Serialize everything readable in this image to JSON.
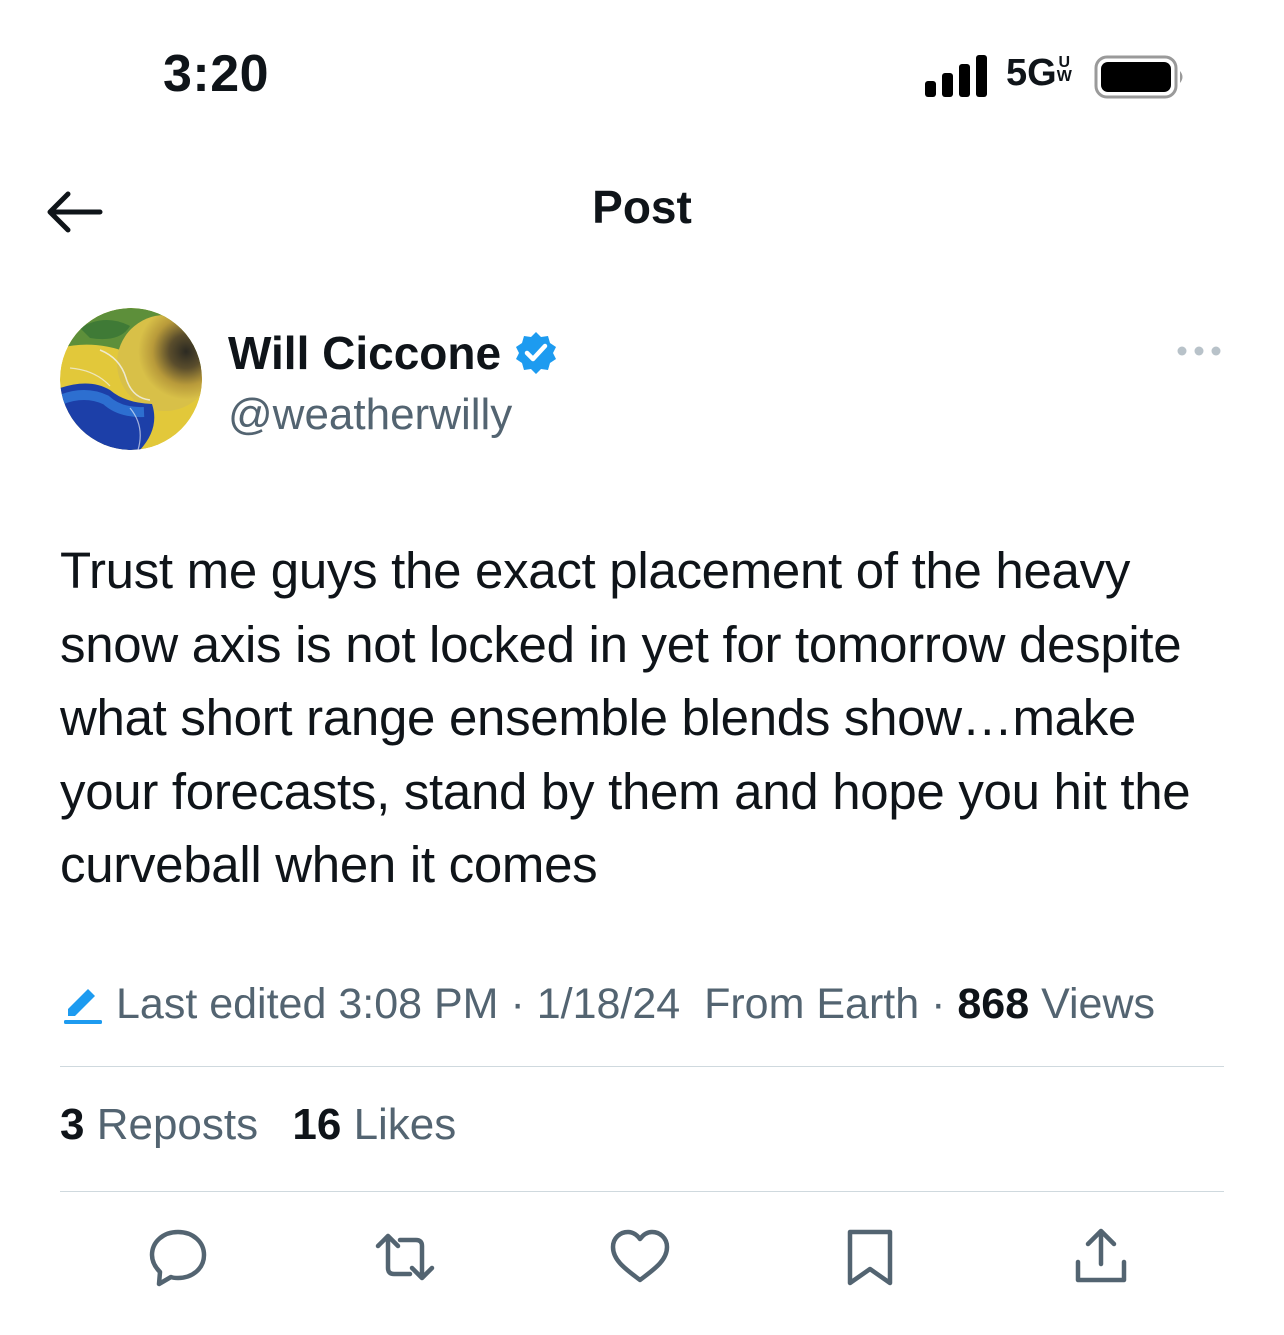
{
  "status_bar": {
    "time": "3:20",
    "network": "5G",
    "network_suffix_top": "U",
    "network_suffix_bottom": "W"
  },
  "nav": {
    "title": "Post",
    "back_icon": "arrow-left-icon"
  },
  "author": {
    "name": "Will Ciccone",
    "handle": "@weatherwilly",
    "verified": true,
    "avatar": "satellite-weather-map-avatar"
  },
  "post": {
    "text": "Trust me guys the exact placement of the heavy snow axis is not locked in yet for tomorrow despite what short range ensemble blends show…make your forecasts, stand by them and hope you hit the curveball when it comes"
  },
  "meta": {
    "edited_prefix": "Last edited",
    "time": "3:08 PM",
    "sep1": "·",
    "date": "1/18/24",
    "location": "From Earth",
    "sep2": "·",
    "views_count": "868",
    "views_label": "Views"
  },
  "stats": {
    "reposts_count": "3",
    "reposts_label": "Reposts",
    "likes_count": "16",
    "likes_label": "Likes"
  },
  "actions": [
    "reply-icon",
    "repost-icon",
    "like-icon",
    "bookmark-icon",
    "share-icon"
  ],
  "colors": {
    "accent": "#1d9bf0",
    "text": "#0f1419",
    "secondary": "#536471",
    "border": "#cfd9de"
  }
}
